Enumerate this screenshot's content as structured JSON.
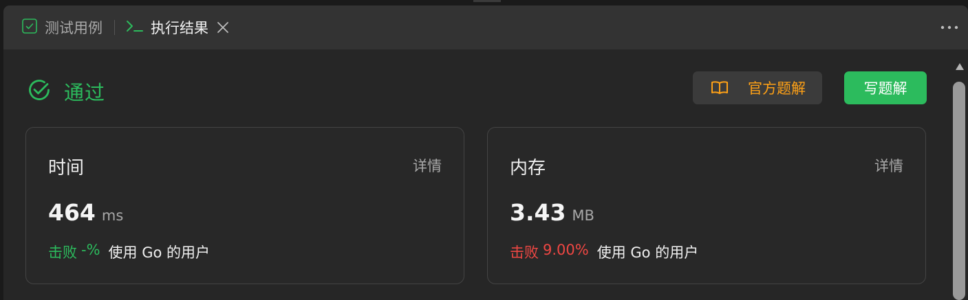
{
  "tabs": [
    {
      "label": "测试用例",
      "icon": "checkbox-icon"
    },
    {
      "label": "执行结果",
      "icon": "terminal-icon",
      "active": true
    }
  ],
  "status": {
    "text": "通过",
    "icon": "check-circle-icon",
    "color": "#2cbb5d"
  },
  "actions": {
    "official_solution": {
      "label": "官方题解",
      "icon": "book-icon",
      "color": "#ffa116"
    },
    "write_solution": {
      "label": "写题解",
      "color": "#2cbb5d"
    }
  },
  "cards": {
    "time": {
      "title": "时间",
      "detail": "详情",
      "value": "464",
      "unit": "ms",
      "beat_label": "击败",
      "beat_pct": "-%",
      "beat_color": "#2cbb5d",
      "tail": "使用 Go 的用户"
    },
    "memory": {
      "title": "内存",
      "detail": "详情",
      "value": "3.43",
      "unit": "MB",
      "beat_label": "击败",
      "beat_pct": "9.00%",
      "beat_color": "#ef4743",
      "tail": "使用 Go 的用户"
    }
  }
}
